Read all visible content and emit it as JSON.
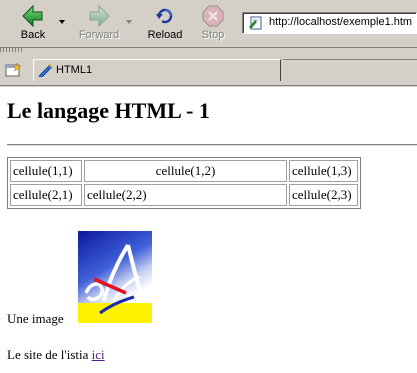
{
  "toolbar": {
    "back_label": "Back",
    "forward_label": "Forward",
    "reload_label": "Reload",
    "stop_label": "Stop"
  },
  "address": {
    "url": "http://localhost/exemple1.htm"
  },
  "tabs": [
    {
      "title": "HTML1"
    }
  ],
  "page": {
    "heading": "Le langage HTML - 1",
    "table": {
      "rows": [
        [
          "cellule(1,1)",
          "cellule(1,2)",
          "cellule(1,3)"
        ],
        [
          "cellule(2,1)",
          "cellule(2,2)",
          "cellule(2,3)"
        ]
      ]
    },
    "image_label": "Une image",
    "site_text": "Le site de l'istia ",
    "site_link": "ici"
  },
  "colors": {
    "chrome": "#d4d0c8",
    "visited_link": "#551a8b",
    "logo_blue": "#1a2bb0",
    "logo_yellow": "#fff200",
    "logo_red": "#e01020"
  },
  "icons": {
    "back": "green-left-arrow-icon",
    "forward": "green-right-arrow-icon",
    "reload": "reload-icon",
    "stop": "stop-icon",
    "page": "page-icon",
    "tab": "html-pencil-icon",
    "new_tab": "new-tab-icon"
  }
}
